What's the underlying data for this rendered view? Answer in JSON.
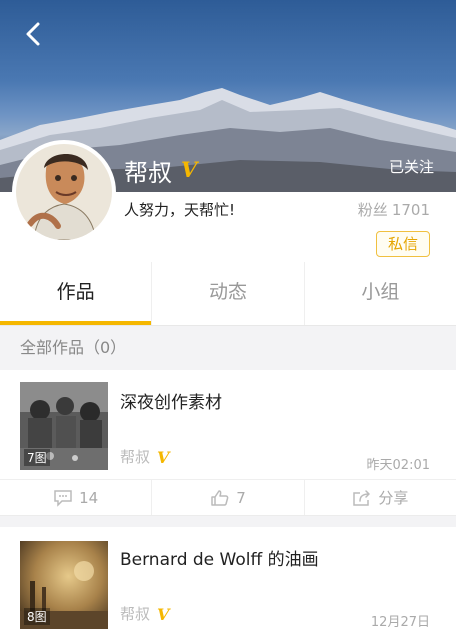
{
  "header": {
    "user_name": "帮叔",
    "verified_mark": "V",
    "follow_status": "已关注"
  },
  "profile": {
    "slogan": "人努力，天帮忙!",
    "fans_label": "粉丝",
    "fans_count": "1701",
    "message_label": "私信"
  },
  "tabs": [
    {
      "label": "作品",
      "active": true
    },
    {
      "label": "动态",
      "active": false
    },
    {
      "label": "小组",
      "active": false
    }
  ],
  "section": {
    "title": "全部作品（0）"
  },
  "works": [
    {
      "title": "深夜创作素材",
      "image_count": "7图",
      "author": "帮叔",
      "verified_mark": "V",
      "date": "昨天02:01",
      "comments": "14",
      "likes": "7",
      "share_label": "分享"
    },
    {
      "title": "Bernard de Wolff 的油画",
      "image_count": "8图",
      "author": "帮叔",
      "verified_mark": "V",
      "date": "12月27日"
    }
  ],
  "colors": {
    "accent": "#f5b700",
    "sky_top": "#2e5c97",
    "muted_text": "#aaaaaa"
  }
}
